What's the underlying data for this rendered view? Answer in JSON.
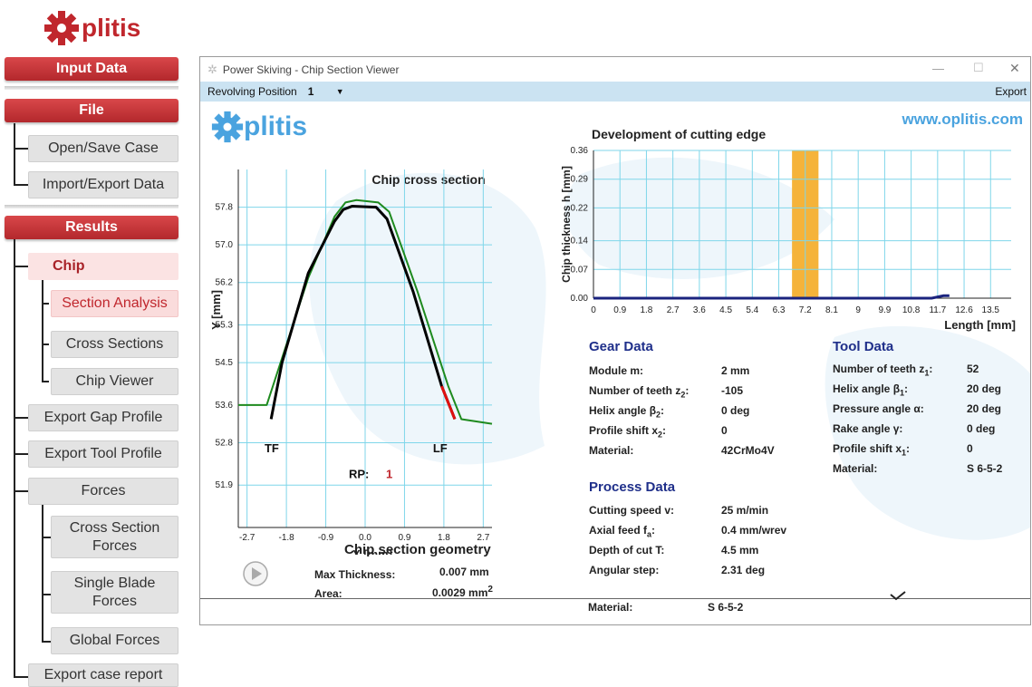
{
  "brand": {
    "logo_text": "plitis",
    "url_text": "www.oplitis.com"
  },
  "sidebar": {
    "input_data": "Input Data",
    "file": "File",
    "open_save": "Open/Save Case",
    "import_export": "Import/Export Data",
    "results": "Results",
    "chip": "Chip",
    "section_analysis": "Section Analysis",
    "cross_sections": "Cross Sections",
    "chip_viewer": "Chip Viewer",
    "export_gap": "Export Gap Profile",
    "export_tool": "Export Tool Profile",
    "forces": "Forces",
    "cross_section_forces": "Cross Section Forces",
    "single_blade_forces": "Single Blade Forces",
    "global_forces": "Global Forces",
    "export_report": "Export case report"
  },
  "window": {
    "title": "Power Skiving - Chip Section Viewer",
    "revolving_label": "Revolving Position",
    "revolving_value": "1",
    "export_label": "Export"
  },
  "chip_chart": {
    "title": "Chip cross section",
    "xlabel": "X [mm]",
    "ylabel": "Y [mm]",
    "tf": "TF",
    "lf": "LF",
    "rp_label": "RP:",
    "rp_value": "1"
  },
  "geometry": {
    "title": "Chip section geometry",
    "max_thickness_label": "Max Thickness:",
    "max_thickness_value": "0.007 mm",
    "area_label": "Area:",
    "area_value": "0.0029 mm",
    "area_sup": "2"
  },
  "gear": {
    "title": "Gear Data",
    "rows": [
      {
        "label": "Module m:",
        "value": "2 mm"
      },
      {
        "label": "Number of teeth z",
        "sub": "2",
        "tail": ":",
        "value": "-105"
      },
      {
        "label": "Helix angle β",
        "sub": "2",
        "tail": ":",
        "value": "0 deg"
      },
      {
        "label": "Profile shift x",
        "sub": "2",
        "tail": ":",
        "value": "0"
      },
      {
        "label": "Material:",
        "value": "42CrMo4V"
      }
    ]
  },
  "tool": {
    "title": "Tool Data",
    "rows": [
      {
        "label": "Number of teeth z",
        "sub": "1",
        "tail": ":",
        "value": "52"
      },
      {
        "label": "Helix angle β",
        "sub": "1",
        "tail": ":",
        "value": "20 deg"
      },
      {
        "label": "Pressure angle α:",
        "value": "20 deg"
      },
      {
        "label": "Rake angle γ:",
        "value": "0 deg"
      },
      {
        "label": "Profile shift x",
        "sub": "1",
        "tail": ":",
        "value": "0"
      },
      {
        "label": "Material:",
        "value": "S 6-5-2"
      }
    ]
  },
  "process": {
    "title": "Process Data",
    "rows": [
      {
        "label": "Cutting speed v:",
        "value": "25 m/min"
      },
      {
        "label": "Axial feed f",
        "sub": "a",
        "tail": ":",
        "value": "0.4 mm/wrev"
      },
      {
        "label": "Depth of cut T:",
        "value": "4.5 mm"
      },
      {
        "label": "Angular step:",
        "value": "2.31 deg"
      }
    ],
    "cut_material_label": "Material:",
    "cut_material_value": "S 6-5-2"
  },
  "colors": {
    "brand_red": "#c0272d",
    "header_blue": "#1f2f8a",
    "toolbar_blue": "#cbe3f2",
    "grid_cyan": "#7fd6ea",
    "profile_green": "#1e8a1e",
    "highlight_orange": "#f5b33a"
  },
  "chart_data": [
    {
      "type": "line",
      "title": "Chip cross section",
      "xlabel": "X [mm]",
      "ylabel": "Y [mm]",
      "xlim": [
        -2.9,
        2.9
      ],
      "ylim": [
        51.0,
        58.6
      ],
      "x_ticks": [
        "-2.7",
        "-1.8",
        "-0.9",
        "0.0",
        "0.9",
        "1.8",
        "2.7"
      ],
      "y_ticks": [
        "51.9",
        "52.8",
        "53.6",
        "54.5",
        "55.3",
        "56.2",
        "57.0",
        "57.8"
      ],
      "grid": true,
      "series": [
        {
          "color": "#1e8a1e",
          "x": [
            -2.9,
            -2.25,
            -1.3,
            -0.7,
            -0.45,
            -0.2,
            0.3,
            0.55,
            1.2,
            1.9,
            2.2,
            2.9
          ],
          "y": [
            53.6,
            53.6,
            56.3,
            57.6,
            57.9,
            57.95,
            57.9,
            57.7,
            56.0,
            54.0,
            53.3,
            53.2
          ]
        },
        {
          "color": "#000000",
          "x": [
            -2.15,
            -1.9,
            -1.3,
            -0.7,
            -0.5,
            -0.3,
            0.25,
            0.5,
            1.1,
            1.75,
            2.05
          ],
          "y": [
            53.3,
            54.5,
            56.4,
            57.5,
            57.75,
            57.82,
            57.8,
            57.55,
            56.0,
            54.0,
            53.3
          ]
        }
      ]
    },
    {
      "type": "line",
      "title": "Development of cutting edge",
      "xlabel": "Length [mm]",
      "ylabel": "Chip thickness h [mm]",
      "xlim": [
        0,
        14.2
      ],
      "ylim": [
        0,
        0.36
      ],
      "x_ticks": [
        "0",
        "0.9",
        "1.8",
        "2.7",
        "3.6",
        "4.5",
        "5.4",
        "6.3",
        "7.2",
        "8.1",
        "9",
        "9.9",
        "10.8",
        "11.7",
        "12.6",
        "13.5"
      ],
      "y_ticks": [
        "0.00",
        "0.07",
        "0.14",
        "0.22",
        "0.29",
        "0.36"
      ],
      "grid": true,
      "highlight_range": [
        6.75,
        7.65
      ],
      "series": [
        {
          "color": "#1a237e",
          "x": [
            0,
            11.5,
            11.9,
            12.1
          ],
          "y": [
            0,
            0,
            0.006,
            0.006
          ]
        }
      ]
    }
  ]
}
